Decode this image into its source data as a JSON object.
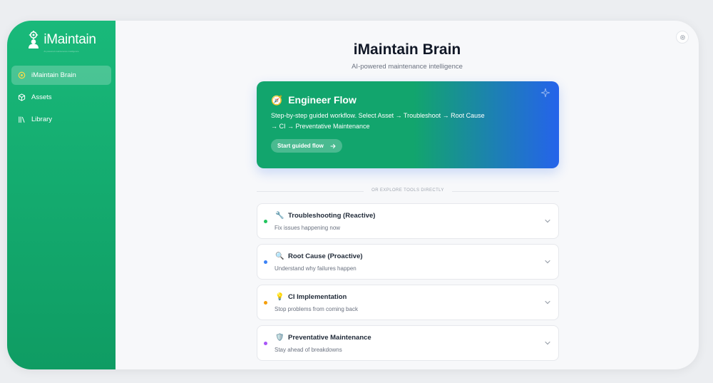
{
  "brand": {
    "name": "iMaintain",
    "tagline": "AI-powered maintenance intelligence"
  },
  "sidebar": {
    "items": [
      {
        "label": "iMaintain Brain",
        "icon": "brain-icon",
        "active": true
      },
      {
        "label": "Assets",
        "icon": "cube-icon",
        "active": false
      },
      {
        "label": "Library",
        "icon": "library-icon",
        "active": false
      }
    ]
  },
  "header": {
    "title": "iMaintain Brain",
    "subtitle": "AI-powered maintenance intelligence",
    "settings_icon": "gear-icon"
  },
  "hero": {
    "emoji": "🧭",
    "title": "Engineer Flow",
    "description": "Step-by-step guided workflow. Select Asset → Troubleshoot → Root Cause → CI → Preventative Maintenance",
    "button_label": "Start guided flow",
    "button_icon": "arrow-right-icon",
    "corner_icon": "sparkle-icon",
    "colors": {
      "start": "#12a56d",
      "end": "#2563eb"
    }
  },
  "divider": {
    "label": "OR EXPLORE TOOLS DIRECTLY"
  },
  "tools": [
    {
      "emoji": "🔧",
      "title": "Troubleshooting (Reactive)",
      "subtitle": "Fix issues happening now",
      "dot_color": "#22c55e"
    },
    {
      "emoji": "🔍",
      "title": "Root Cause (Proactive)",
      "subtitle": "Understand why failures happen",
      "dot_color": "#3b82f6"
    },
    {
      "emoji": "💡",
      "title": "CI Implementation",
      "subtitle": "Stop problems from coming back",
      "dot_color": "#f59e0b"
    },
    {
      "emoji": "🛡️",
      "title": "Preventative Maintenance",
      "subtitle": "Stay ahead of breakdowns",
      "dot_color": "#a855f7"
    }
  ]
}
